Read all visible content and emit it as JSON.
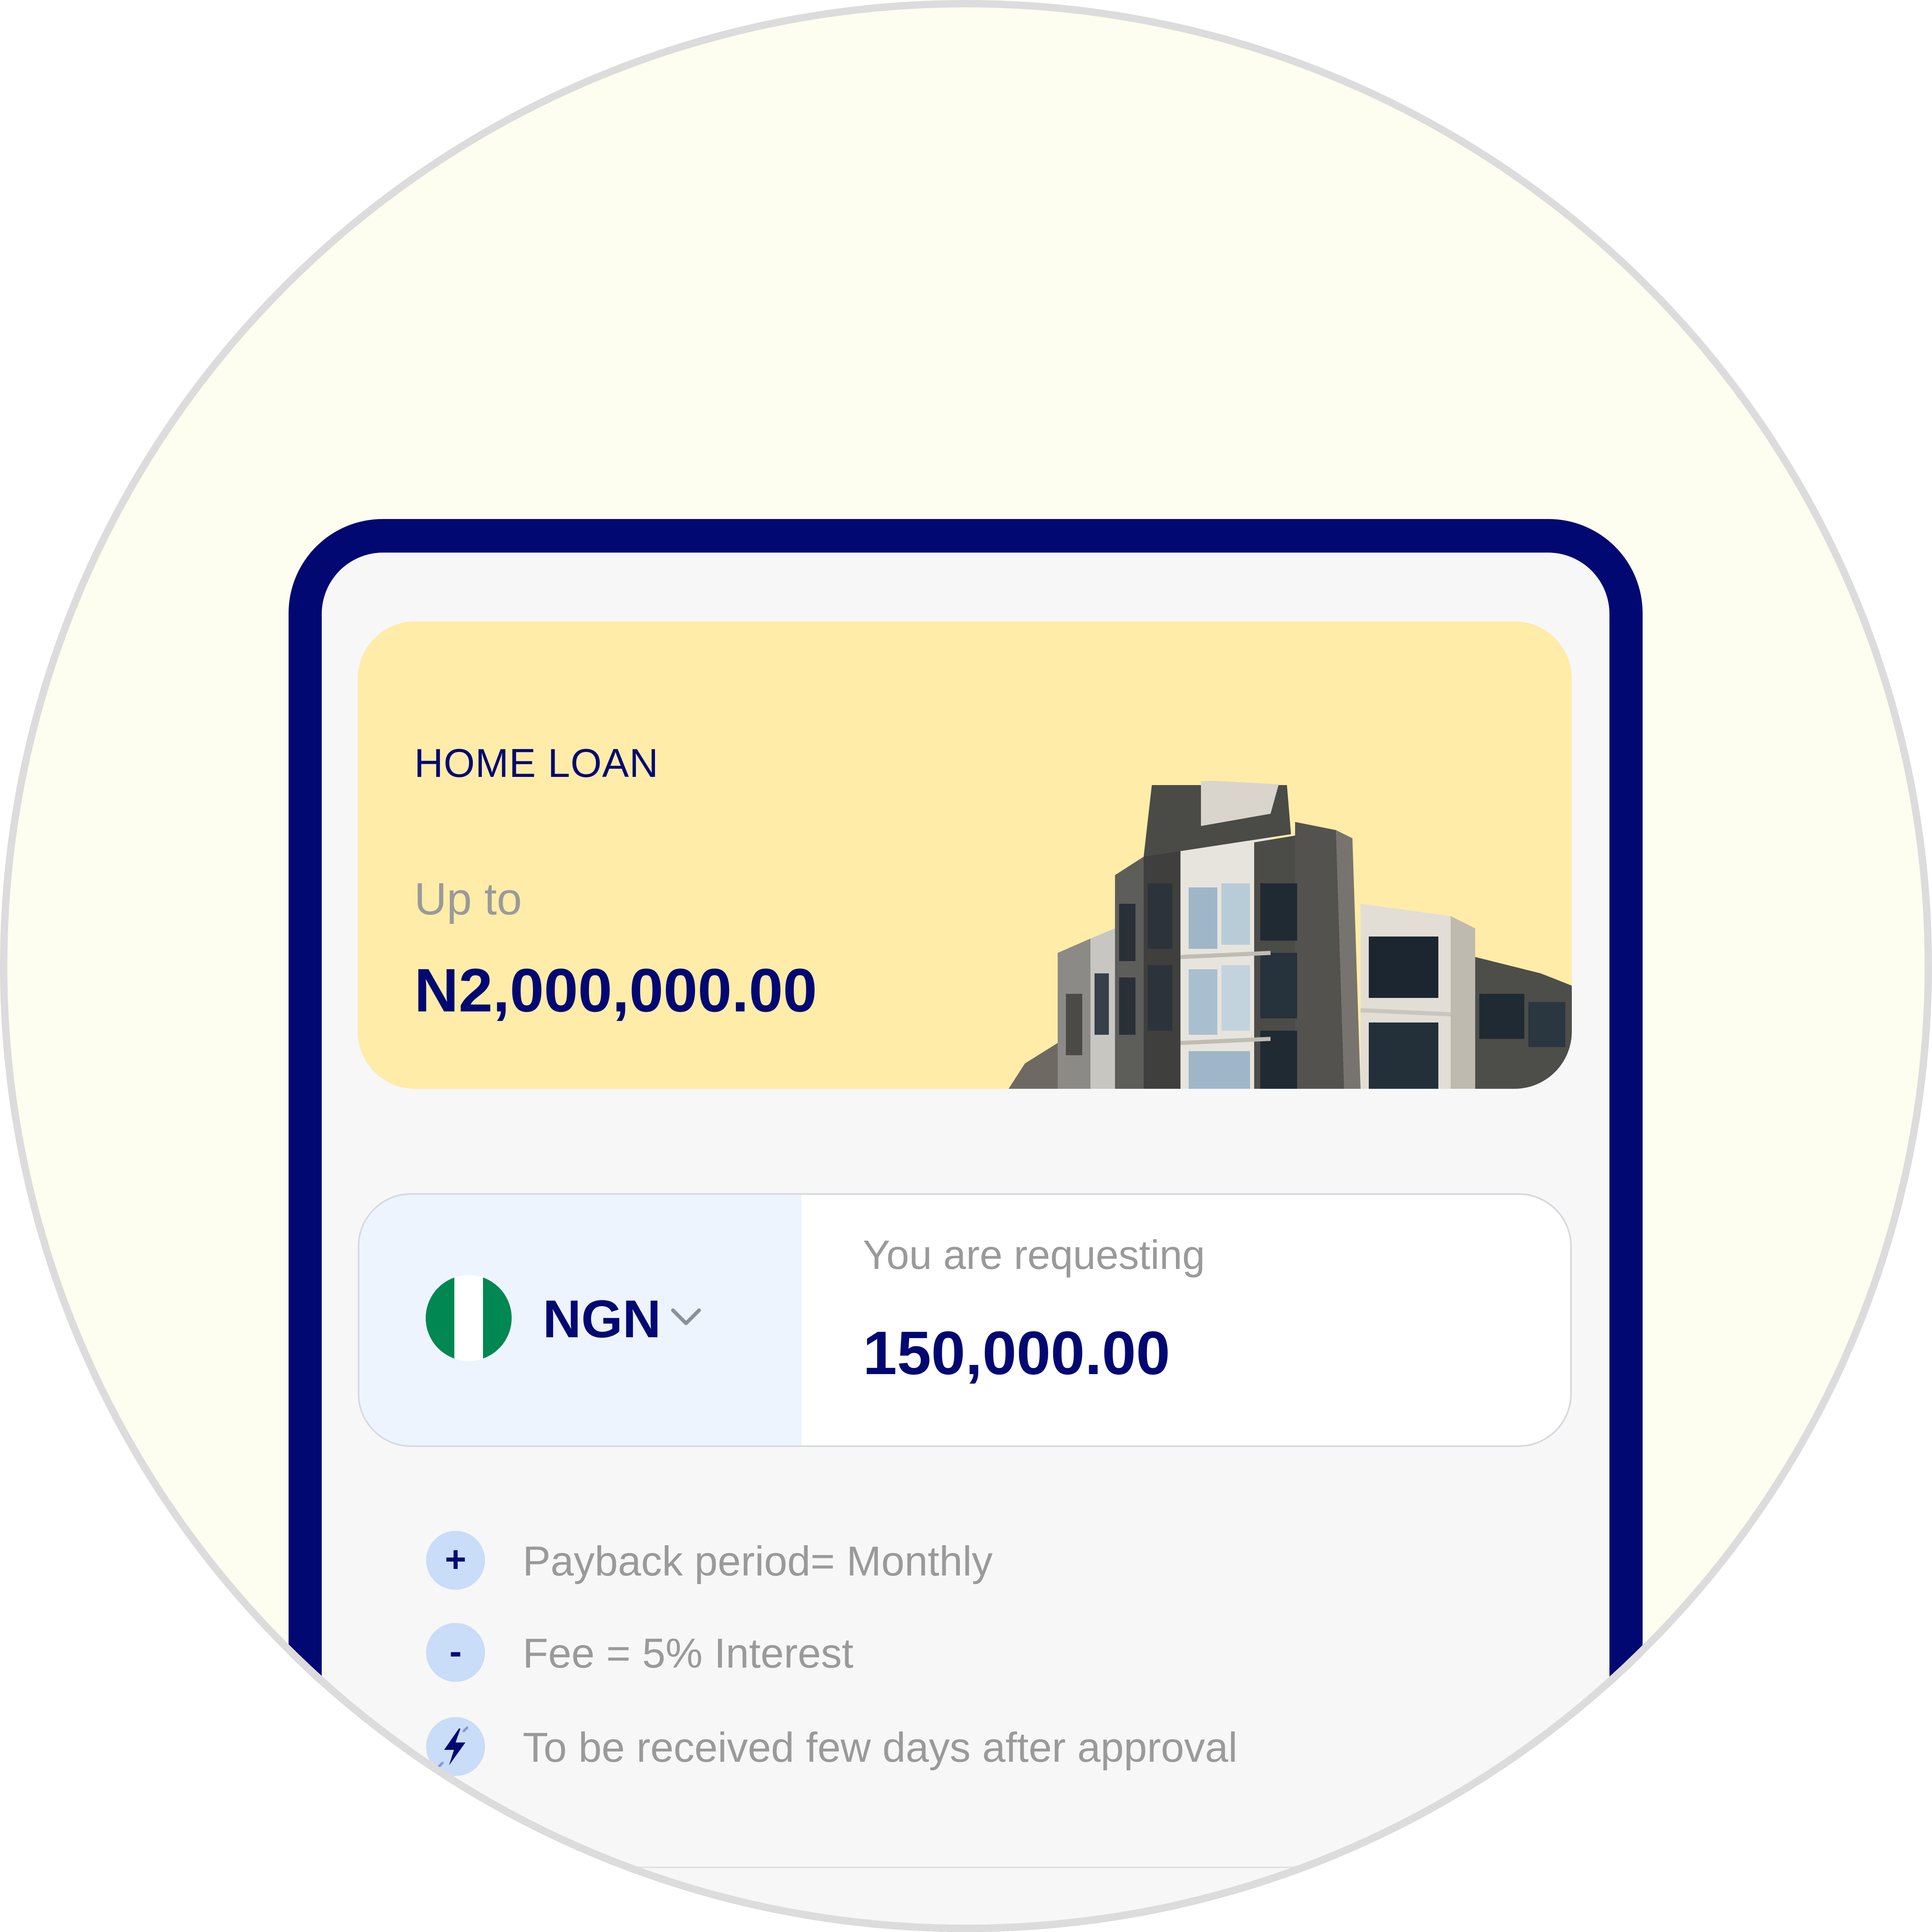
{
  "loan_card": {
    "title": "HOME LOAN",
    "upto_label": "Up to",
    "max_amount": "N2,000,000.00",
    "image": "apartment-building-photo"
  },
  "request": {
    "currency": {
      "code": "NGN",
      "flag": "nigeria-flag",
      "dropdown_icon": "chevron-down-icon"
    },
    "label": "You are requesting",
    "amount": "150,000.00"
  },
  "details": [
    {
      "icon": "plus-icon",
      "symbol": "+",
      "text": "Payback period= Monthly"
    },
    {
      "icon": "minus-icon",
      "symbol": "-",
      "text": "Fee = 5% Interest"
    },
    {
      "icon": "lightning-icon",
      "symbol": "",
      "text": "To be received few days after approval"
    }
  ],
  "colors": {
    "brand_navy": "#020872",
    "card_yellow": "#feeca8",
    "background": "#fdfeef",
    "icon_bg": "#c9dcf8",
    "muted_text": "#9a9a9a"
  }
}
